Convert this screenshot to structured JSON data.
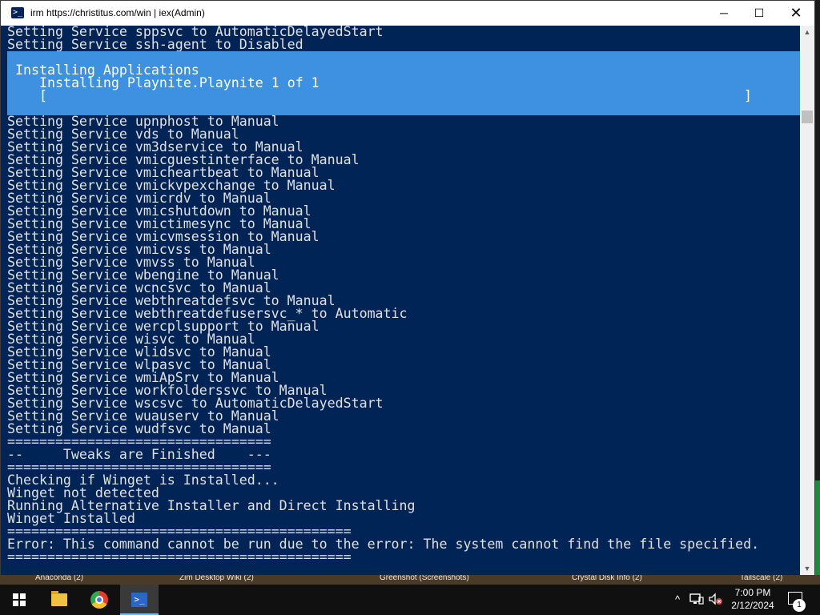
{
  "window": {
    "title": "irm https://christitus.com/win | iex(Admin)",
    "controls": {
      "minimize": "─",
      "maximize": "☐",
      "close": "✕"
    }
  },
  "console": {
    "lines": [
      "Setting Service sppsvc to AutomaticDelayedStart",
      "Setting Service ssh-agent to Disabled"
    ],
    "progress": {
      "activity": "Installing Applications",
      "status": "Installing Playnite.Playnite 1 of 1",
      "bar_open": "[",
      "bar_close": "]",
      "percent": 0
    },
    "lines_after": [
      "Setting Service upnphost to Manual",
      "Setting Service vds to Manual",
      "Setting Service vm3dservice to Manual",
      "Setting Service vmicguestinterface to Manual",
      "Setting Service vmicheartbeat to Manual",
      "Setting Service vmickvpexchange to Manual",
      "Setting Service vmicrdv to Manual",
      "Setting Service vmicshutdown to Manual",
      "Setting Service vmictimesync to Manual",
      "Setting Service vmicvmsession to Manual",
      "Setting Service vmicvss to Manual",
      "Setting Service vmvss to Manual",
      "Setting Service wbengine to Manual",
      "Setting Service wcncsvc to Manual",
      "Setting Service webthreatdefsvc to Manual",
      "Setting Service webthreatdefusersvc_* to Automatic",
      "Setting Service wercplsupport to Manual",
      "Setting Service wisvc to Manual",
      "Setting Service wlidsvc to Manual",
      "Setting Service wlpasvc to Manual",
      "Setting Service wmiApSrv to Manual",
      "Setting Service workfolderssvc to Manual",
      "Setting Service wscsvc to AutomaticDelayedStart",
      "Setting Service wuauserv to Manual",
      "Setting Service wudfsvc to Manual",
      "=================================",
      "--     Tweaks are Finished    ---",
      "=================================",
      "Checking if Winget is Installed...",
      "Winget not detected",
      "Running Alternative Installer and Direct Installing",
      "Winget Installed",
      "===========================================",
      "Error: This command cannot be run due to the error: The system cannot find the file specified.",
      "==========================================="
    ]
  },
  "scrollbar": {
    "up": "▲",
    "down": "▼"
  },
  "desktop": {
    "labels": [
      "Anaconda (2)",
      "Zim Desktop Wiki (2)",
      "Greenshot (Screenshots)",
      "Crystal Disk Info (2)",
      "Tailscale (2)"
    ]
  },
  "taskbar": {
    "ps_glyph": ">_",
    "tray": {
      "chevron": "^",
      "time": "7:00 PM",
      "date": "2/12/2024",
      "notification_count": "1"
    }
  },
  "colors": {
    "console_bg": "#012456",
    "console_fg": "#e0e0e0",
    "progress_bg": "#3e91e0",
    "progress_fg": "#ffffe0",
    "taskbar_bg": "#101010"
  }
}
